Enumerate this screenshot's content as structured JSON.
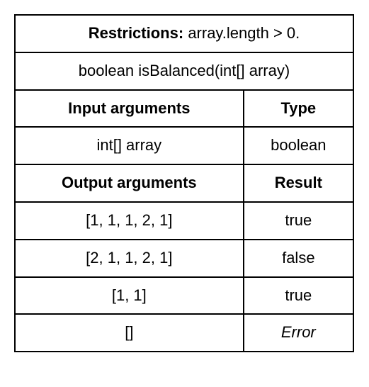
{
  "restrictions": {
    "label": "Restrictions:",
    "text": "array.length > 0."
  },
  "signature": "boolean isBalanced(int[] array)",
  "headers": {
    "input_args": "Input arguments",
    "type": "Type",
    "output_args": "Output arguments",
    "result": "Result"
  },
  "input_row": {
    "arg": "int[] array",
    "type": "boolean"
  },
  "examples": [
    {
      "input": "[1, 1, 1, 2, 1]",
      "result": "true",
      "error": false
    },
    {
      "input": "[2, 1, 1, 2, 1]",
      "result": "false",
      "error": false
    },
    {
      "input": "[1, 1]",
      "result": "true",
      "error": false
    },
    {
      "input": "[]",
      "result": "Error",
      "error": true
    }
  ]
}
